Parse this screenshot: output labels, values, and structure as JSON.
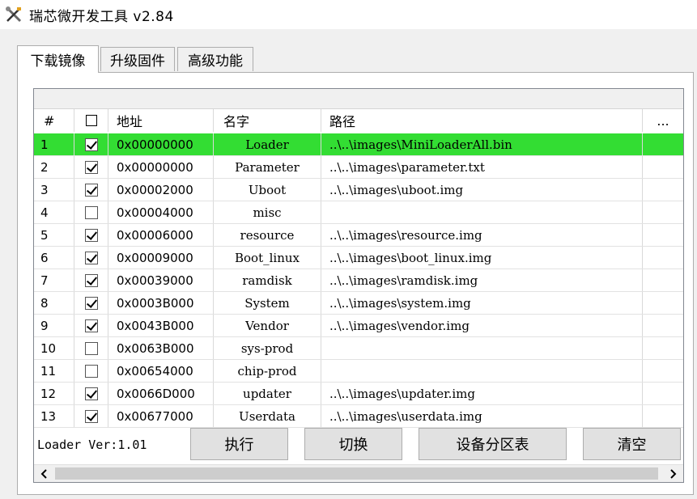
{
  "window": {
    "title": "瑞芯微开发工具 v2.84",
    "icon": "screwdriver-wrench-icon"
  },
  "tabs": [
    {
      "label": "下载镜像",
      "active": true
    },
    {
      "label": "升级固件",
      "active": false
    },
    {
      "label": "高级功能",
      "active": false
    }
  ],
  "table": {
    "columns": [
      "#",
      "",
      "地址",
      "名字",
      "路径",
      "..."
    ],
    "rows": [
      {
        "num": "1",
        "checked": true,
        "address": "0x00000000",
        "name": "Loader",
        "path": "..\\..\\images\\MiniLoaderAll.bin",
        "selected": true
      },
      {
        "num": "2",
        "checked": true,
        "address": "0x00000000",
        "name": "Parameter",
        "path": "..\\..\\images\\parameter.txt"
      },
      {
        "num": "3",
        "checked": true,
        "address": "0x00002000",
        "name": "Uboot",
        "path": "..\\..\\images\\uboot.img"
      },
      {
        "num": "4",
        "checked": false,
        "address": "0x00004000",
        "name": "misc",
        "path": ""
      },
      {
        "num": "5",
        "checked": true,
        "address": "0x00006000",
        "name": "resource",
        "path": "..\\..\\images\\resource.img"
      },
      {
        "num": "6",
        "checked": true,
        "address": "0x00009000",
        "name": "Boot_linux",
        "path": "..\\..\\images\\boot_linux.img"
      },
      {
        "num": "7",
        "checked": true,
        "address": "0x00039000",
        "name": "ramdisk",
        "path": "..\\..\\images\\ramdisk.img"
      },
      {
        "num": "8",
        "checked": true,
        "address": "0x0003B000",
        "name": "System",
        "path": "..\\..\\images\\system.img"
      },
      {
        "num": "9",
        "checked": true,
        "address": "0x0043B000",
        "name": "Vendor",
        "path": "..\\..\\images\\vendor.img"
      },
      {
        "num": "10",
        "checked": false,
        "address": "0x0063B000",
        "name": "sys-prod",
        "path": ""
      },
      {
        "num": "11",
        "checked": false,
        "address": "0x00654000",
        "name": "chip-prod",
        "path": ""
      },
      {
        "num": "12",
        "checked": true,
        "address": "0x0066D000",
        "name": "updater",
        "path": "..\\..\\images\\updater.img"
      },
      {
        "num": "13",
        "checked": true,
        "address": "0x00677000",
        "name": "Userdata",
        "path": "..\\..\\images\\userdata.img"
      }
    ],
    "selected_row_color": "#33dd33"
  },
  "footer": {
    "loader_version": "Loader Ver:1.01",
    "buttons": {
      "run": "执行",
      "switch": "切换",
      "partition_table": "设备分区表",
      "clear": "清空"
    }
  }
}
